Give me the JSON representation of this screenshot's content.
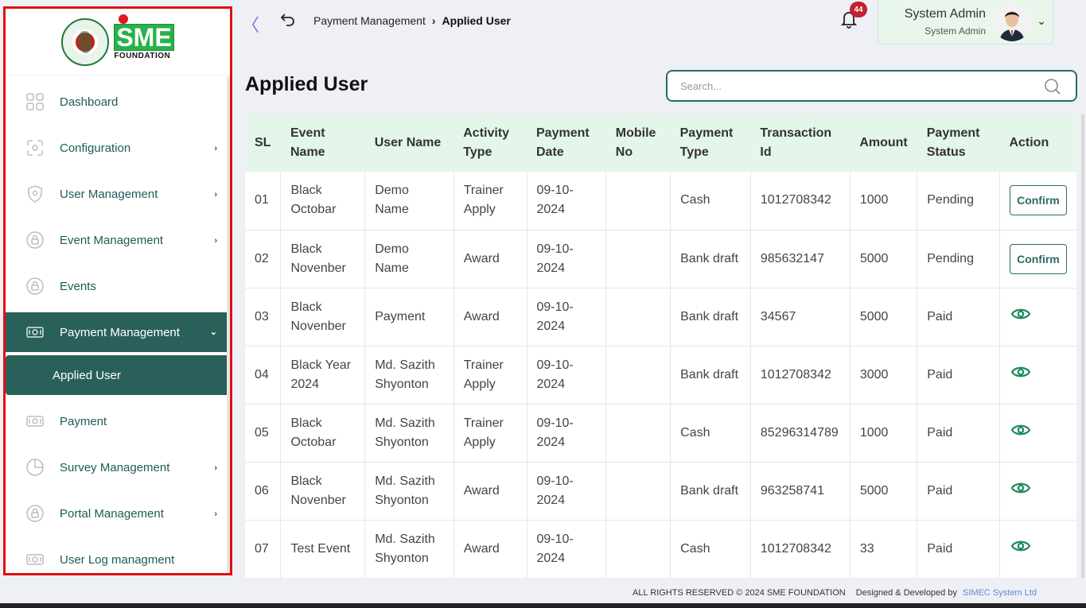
{
  "brand": {
    "logo_text": "SME",
    "logo_subtext": "FOUNDATION"
  },
  "sidebar": {
    "items": [
      {
        "label": "Dashboard",
        "icon": "dashboard-icon",
        "has_submenu": false
      },
      {
        "label": "Configuration",
        "icon": "configuration-icon",
        "has_submenu": true
      },
      {
        "label": "User Management",
        "icon": "shield-icon",
        "has_submenu": true
      },
      {
        "label": "Event Management",
        "icon": "lock-icon",
        "has_submenu": true
      },
      {
        "label": "Events",
        "icon": "lock-icon",
        "has_submenu": false
      },
      {
        "label": "Payment Management",
        "icon": "money-icon",
        "has_submenu": true,
        "active": true
      },
      {
        "label": "Payment",
        "icon": "money-icon",
        "has_submenu": false
      },
      {
        "label": "Survey Management",
        "icon": "pie-chart-icon",
        "has_submenu": true
      },
      {
        "label": "Portal Management",
        "icon": "lock-icon",
        "has_submenu": true
      },
      {
        "label": "User Log managment",
        "icon": "money-icon",
        "has_submenu": false
      }
    ],
    "submenu": {
      "label": "Applied User"
    }
  },
  "header": {
    "breadcrumb": {
      "parent": "Payment Management",
      "current": "Applied User"
    },
    "notifications_count": "44",
    "user": {
      "name": "System Admin",
      "role": "System Admin"
    }
  },
  "page": {
    "title": "Applied User",
    "search_placeholder": "Search..."
  },
  "table": {
    "columns": [
      "SL",
      "Event Name",
      "User Name",
      "Activity Type",
      "Payment Date",
      "Mobile No",
      "Payment Type",
      "Transaction Id",
      "Amount",
      "Payment Status",
      "Action"
    ],
    "rows": [
      {
        "sl": "01",
        "event": "Black Octobar",
        "user": "Demo Name",
        "activity": "Trainer Apply",
        "date": "09-10-2024",
        "mobile": "",
        "ptype": "Cash",
        "txn": "1012708342",
        "amount": "1000",
        "status": "Pending",
        "action": "Confirm"
      },
      {
        "sl": "02",
        "event": "Black Novenber",
        "user": "Demo Name",
        "activity": "Award",
        "date": "09-10-2024",
        "mobile": "",
        "ptype": "Bank draft",
        "txn": "985632147",
        "amount": "5000",
        "status": "Pending",
        "action": "Confirm"
      },
      {
        "sl": "03",
        "event": "Black Novenber",
        "user": "Payment",
        "activity": "Award",
        "date": "09-10-2024",
        "mobile": "",
        "ptype": "Bank draft",
        "txn": "34567",
        "amount": "5000",
        "status": "Paid",
        "action": "view"
      },
      {
        "sl": "04",
        "event": "Black Year 2024",
        "user": "Md. Sazith Shyonton",
        "activity": "Trainer Apply",
        "date": "09-10-2024",
        "mobile": "",
        "ptype": "Bank draft",
        "txn": "1012708342",
        "amount": "3000",
        "status": "Paid",
        "action": "view"
      },
      {
        "sl": "05",
        "event": "Black Octobar",
        "user": "Md. Sazith Shyonton",
        "activity": "Trainer Apply",
        "date": "09-10-2024",
        "mobile": "",
        "ptype": "Cash",
        "txn": "85296314789",
        "amount": "1000",
        "status": "Paid",
        "action": "view"
      },
      {
        "sl": "06",
        "event": "Black Novenber",
        "user": "Md. Sazith Shyonton",
        "activity": "Award",
        "date": "09-10-2024",
        "mobile": "",
        "ptype": "Bank draft",
        "txn": "963258741",
        "amount": "5000",
        "status": "Paid",
        "action": "view"
      },
      {
        "sl": "07",
        "event": "Test Event",
        "user": "Md. Sazith Shyonton",
        "activity": "Award",
        "date": "09-10-2024",
        "mobile": "",
        "ptype": "Cash",
        "txn": "1012708342",
        "amount": "33",
        "status": "Paid",
        "action": "view"
      }
    ]
  },
  "footer": {
    "copyright": "ALL RIGHTS RESERVED © 2024 SME FOUNDATION",
    "designed_by": "Designed & Developed by",
    "developer": "SIMEC System Ltd"
  },
  "colors": {
    "primary": "#29605a",
    "accent_green": "#27b24a",
    "header_row": "#e4f5ea",
    "badge": "#c4202d",
    "highlight_border": "#e01010"
  }
}
